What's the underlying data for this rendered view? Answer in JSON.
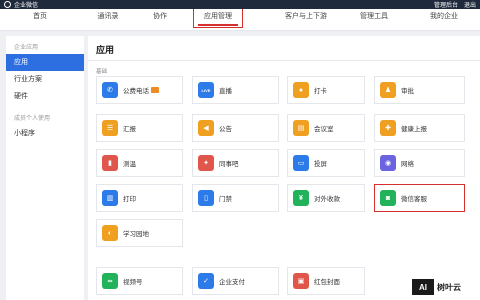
{
  "topbar": {
    "brand": "企业微信",
    "links": [
      "",
      "管理后台",
      "退出"
    ]
  },
  "nav": {
    "tabs": [
      {
        "label": "首页",
        "active": false
      },
      {
        "label": "通讯录",
        "active": false
      },
      {
        "label": "协作",
        "active": false
      },
      {
        "label": "应用管理",
        "active": true
      },
      {
        "label": "客户与上下游",
        "active": false
      },
      {
        "label": "管理工具",
        "active": false
      },
      {
        "label": "我的企业",
        "active": false
      }
    ]
  },
  "sidebar": {
    "group1": "企业应用",
    "items1": [
      {
        "label": "应用",
        "active": true
      },
      {
        "label": "行业方案",
        "active": false
      },
      {
        "label": "硬件",
        "active": false
      }
    ],
    "group2": "成员个人使用",
    "items2": [
      {
        "label": "小程序",
        "active": false
      }
    ]
  },
  "main": {
    "title": "应用",
    "section_label": "基础",
    "apps": [
      {
        "label": "公费电话",
        "icon": "phone-icon",
        "color": "#2d7be8",
        "glyph": "✆",
        "badge": true
      },
      {
        "label": "直播",
        "icon": "live-icon",
        "color": "#2d7be8",
        "glyph": "LIVE",
        "badge": false
      },
      {
        "label": "打卡",
        "icon": "location-pin-icon",
        "color": "#f0a020",
        "glyph": "●",
        "badge": false
      },
      {
        "label": "审批",
        "icon": "approval-stamp-icon",
        "color": "#f0a020",
        "glyph": "♟",
        "badge": false
      },
      {
        "label": "汇报",
        "icon": "report-icon",
        "color": "#f0a020",
        "glyph": "☰",
        "badge": false
      },
      {
        "label": "公告",
        "icon": "megaphone-icon",
        "color": "#f0a020",
        "glyph": "◀",
        "badge": false
      },
      {
        "label": "会议室",
        "icon": "meeting-room-icon",
        "color": "#f0a020",
        "glyph": "▤",
        "badge": false
      },
      {
        "label": "健康上报",
        "icon": "health-report-icon",
        "color": "#f0a020",
        "glyph": "✚",
        "badge": false
      },
      {
        "label": "测温",
        "icon": "thermometer-icon",
        "color": "#e0564a",
        "glyph": "▮",
        "badge": false
      },
      {
        "label": "同事吧",
        "icon": "colleague-forum-icon",
        "color": "#e0564a",
        "glyph": "✦",
        "badge": false
      },
      {
        "label": "投屏",
        "icon": "screen-cast-icon",
        "color": "#2d7be8",
        "glyph": "▭",
        "badge": false
      },
      {
        "label": "网络",
        "icon": "network-icon",
        "color": "#6b63e0",
        "glyph": "◉",
        "badge": false
      },
      {
        "label": "打印",
        "icon": "printer-icon",
        "color": "#2d7be8",
        "glyph": "▥",
        "badge": false
      },
      {
        "label": "门禁",
        "icon": "door-access-icon",
        "color": "#2d7be8",
        "glyph": "▯",
        "badge": false
      },
      {
        "label": "对外收款",
        "icon": "payment-icon",
        "color": "#22b35a",
        "glyph": "¥",
        "badge": false
      },
      {
        "label": "微信客服",
        "icon": "wechat-service-icon",
        "color": "#22b35a",
        "glyph": "◙",
        "badge": false,
        "highlight": true
      },
      {
        "label": "学习园地",
        "icon": "learning-icon",
        "color": "#f0a020",
        "glyph": "◐",
        "badge": false
      },
      {
        "label": "视频号",
        "icon": "video-channel-icon",
        "color": "#22b35a",
        "glyph": "∞",
        "badge": false
      },
      {
        "label": "企业支付",
        "icon": "enterprise-pay-icon",
        "color": "#2d7be8",
        "glyph": "✓",
        "badge": false
      },
      {
        "label": "红包封面",
        "icon": "red-packet-icon",
        "color": "#e0564a",
        "glyph": "▣",
        "badge": false
      }
    ]
  },
  "watermark": {
    "logo": "AI",
    "text": "树叶云"
  }
}
